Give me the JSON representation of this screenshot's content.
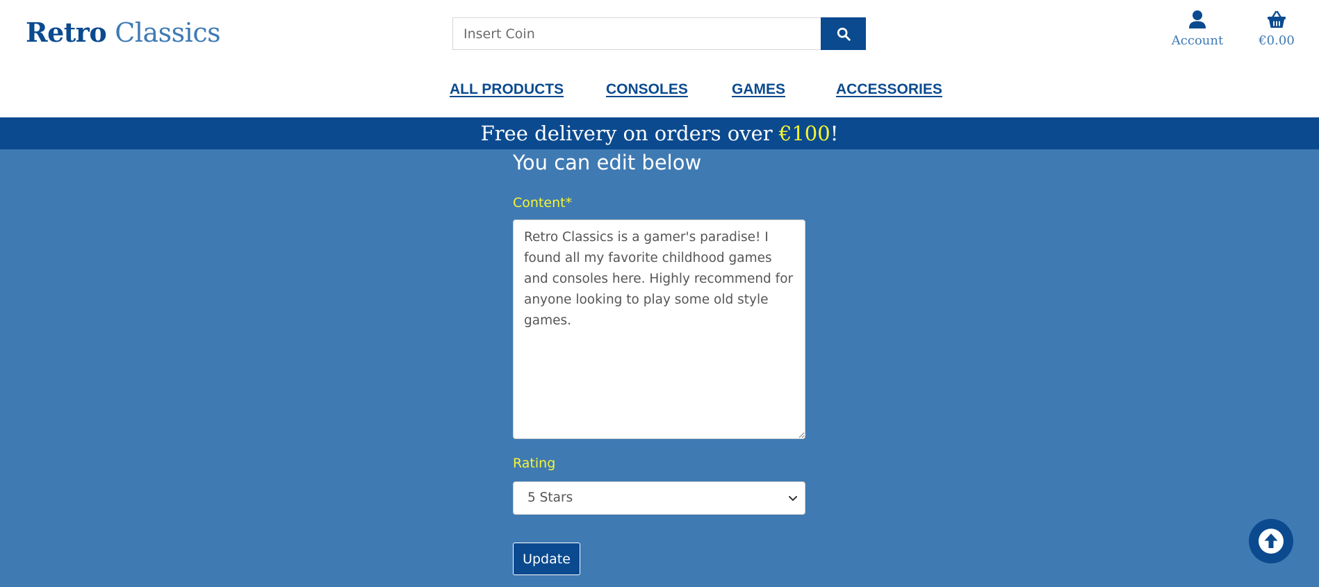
{
  "header": {
    "logo_bold": "Retro",
    "logo_light": "Classics",
    "search": {
      "placeholder": "Insert Coin",
      "button_icon": "search-icon"
    },
    "account_label": "Account",
    "account_icon": "user-icon",
    "cart_total": "€0.00",
    "cart_icon": "basket-icon"
  },
  "nav": {
    "items": [
      {
        "label": "ALL PRODUCTS"
      },
      {
        "label": "CONSOLES"
      },
      {
        "label": "GAMES"
      },
      {
        "label": "ACCESSORIES"
      }
    ]
  },
  "banner": {
    "text_before": "Free delivery on orders over ",
    "highlight": "€100",
    "text_after": "!"
  },
  "form": {
    "heading": "You can edit below",
    "content_label": "Content*",
    "content_value": "Retro Classics is a gamer's paradise! I found all my favorite childhood games and consoles here. Highly recommend for anyone looking to play some old style games.",
    "rating_label": "Rating",
    "rating_selected": "5 Stars",
    "submit_label": "Update"
  },
  "back_to_top_icon": "arrow-up-circle-icon",
  "colors": {
    "brand_dark": "#0b4a8f",
    "brand_light": "#3f7ab3",
    "accent_yellow": "#f6f631",
    "page_bg": "#3f7ab3"
  }
}
